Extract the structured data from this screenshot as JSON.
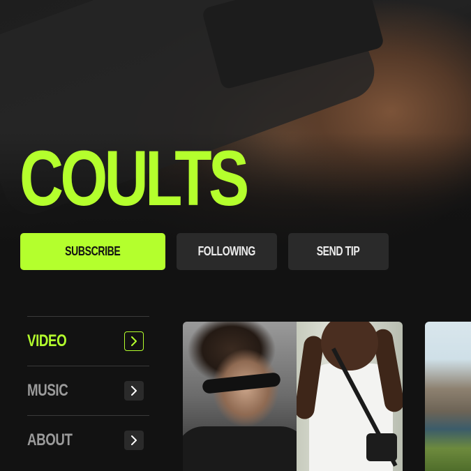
{
  "brand": {
    "name": "COULTS",
    "accent_color": "#b4ff2d",
    "background_color": "#121212"
  },
  "actions": {
    "subscribe_label": "SUBSCRIBE",
    "following_label": "FOLLOWING",
    "send_tip_label": "SEND TIP"
  },
  "menu": {
    "items": [
      {
        "label": "VIDEO",
        "icon": "chevron-right-icon",
        "active": true
      },
      {
        "label": "MUSIC",
        "icon": "chevron-right-icon",
        "active": false
      },
      {
        "label": "ABOUT",
        "icon": "chevron-right-icon",
        "active": false
      }
    ]
  },
  "gallery": {
    "items": [
      {
        "subject": "portrait-sunglasses"
      },
      {
        "subject": "portrait-white-tee"
      },
      {
        "subject": "mountain-landscape"
      }
    ]
  }
}
